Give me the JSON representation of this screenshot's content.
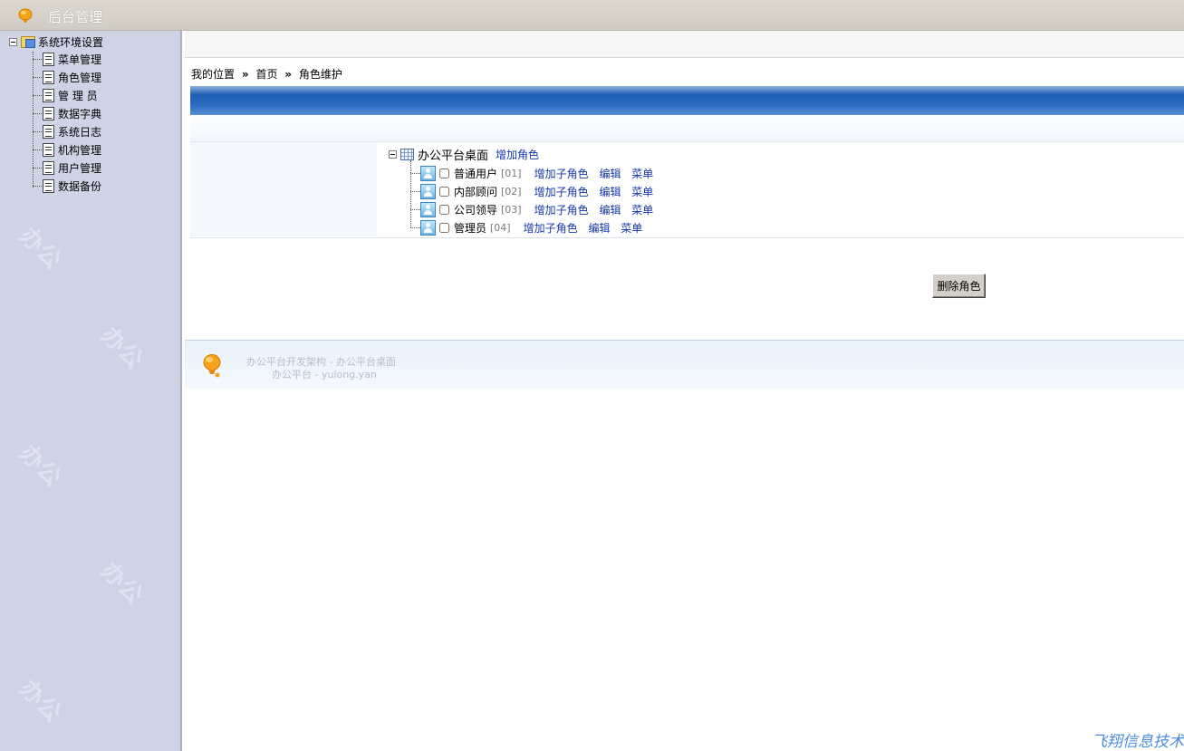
{
  "app": {
    "title": "后台管理"
  },
  "sidebar": {
    "root_label": "系统环境设置",
    "items": [
      {
        "label": "菜单管理"
      },
      {
        "label": "角色管理"
      },
      {
        "label": "管 理 员"
      },
      {
        "label": "数据字典"
      },
      {
        "label": "系统日志"
      },
      {
        "label": "机构管理"
      },
      {
        "label": "用户管理"
      },
      {
        "label": "数据备份"
      }
    ]
  },
  "breadcrumb": {
    "prefix": "我的位置",
    "separator": "»",
    "home": "首页",
    "current": "角色维护"
  },
  "role_tree": {
    "root_label": "办公平台桌面",
    "add_role_link": "增加角色",
    "roles": [
      {
        "name": "普通用户",
        "code": "[01]",
        "add_child": "增加子角色",
        "edit": "编辑",
        "menu": "菜单"
      },
      {
        "name": "内部顾问",
        "code": "[02]",
        "add_child": "增加子角色",
        "edit": "编辑",
        "menu": "菜单"
      },
      {
        "name": "公司领导",
        "code": "[03]",
        "add_child": "增加子角色",
        "edit": "编辑",
        "menu": "菜单"
      },
      {
        "name": "管理员",
        "code": "[04]",
        "add_child": "增加子角色",
        "edit": "编辑",
        "menu": "菜单"
      }
    ]
  },
  "actions": {
    "delete_role": "删除角色"
  },
  "footer": {
    "line1": "办公平台开发架构 -  办公平台桌面",
    "line2": "办公平台 -  yulong.yan"
  },
  "corner_brand": "飞翔信息技术",
  "colors": {
    "sidebar_bg": "#cfd3e6",
    "banner_blue": "#1d5fb4",
    "link_blue": "#1436a8"
  }
}
